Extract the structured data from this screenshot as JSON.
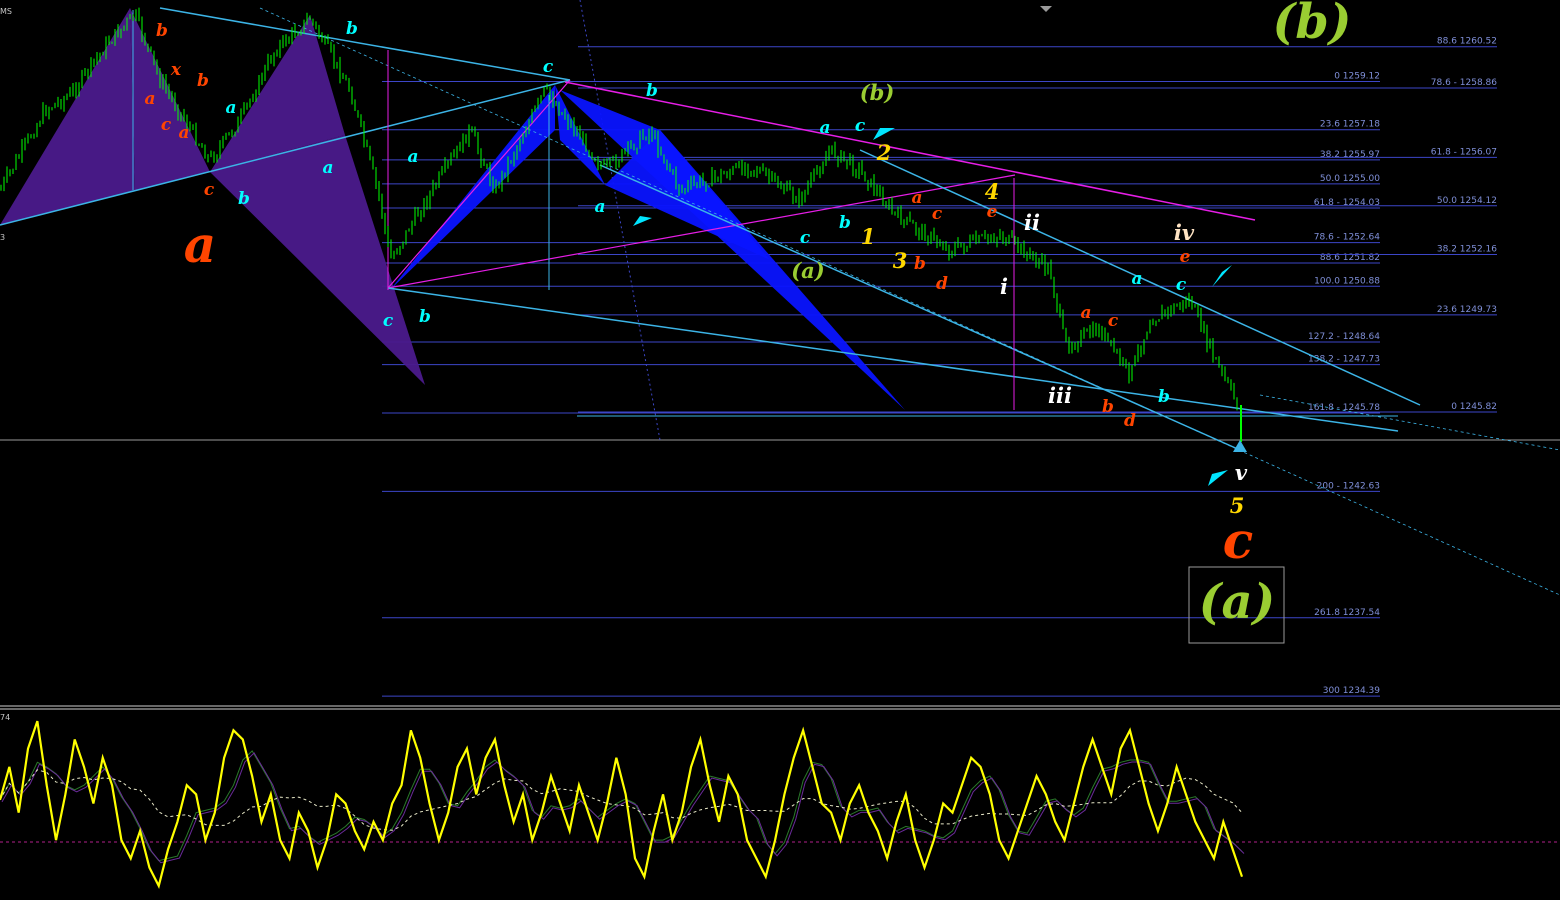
{
  "chart_data": [
    {
      "type": "line",
      "title": "",
      "header_fragment": "MS",
      "left_edge_fragment": "3",
      "fib_levels_left": [
        {
          "label": "0 1259.12",
          "value": 1259.12
        },
        {
          "label": "23.6 1257.18",
          "value": 1257.18
        },
        {
          "label": "38.2 1255.97",
          "value": 1255.97
        },
        {
          "label": "50.0 1255.00",
          "value": 1255.0
        },
        {
          "label": "61.8 - 1254.03",
          "value": 1254.03
        },
        {
          "label": "78.6 - 1252.64",
          "value": 1252.64
        },
        {
          "label": "88.6 1251.82",
          "value": 1251.82
        },
        {
          "label": "100.0 1250.88",
          "value": 1250.88
        },
        {
          "label": "127.2 - 1248.64",
          "value": 1248.64
        },
        {
          "label": "138.2 - 1247.73",
          "value": 1247.73
        },
        {
          "label": "161.8 - 1245.78",
          "value": 1245.78
        },
        {
          "label": "200 - 1242.63",
          "value": 1242.63
        },
        {
          "label": "261.8 1237.54",
          "value": 1237.54
        },
        {
          "label": "300 1234.39",
          "value": 1234.39
        }
      ],
      "fib_levels_right": [
        {
          "label": "88.6 1260.52",
          "value": 1260.52
        },
        {
          "label": "78.6 - 1258.86",
          "value": 1258.86
        },
        {
          "label": "61.8 - 1256.07",
          "value": 1256.07
        },
        {
          "label": "50.0 1254.12",
          "value": 1254.12
        },
        {
          "label": "38.2 1252.16",
          "value": 1252.16
        },
        {
          "label": "23.6 1249.73",
          "value": 1249.73
        },
        {
          "label": "0 1245.82",
          "value": 1245.82
        }
      ],
      "wave_labels": [
        {
          "text": "(b)",
          "color": "#9acd32",
          "size": "xl"
        },
        {
          "text": "(b)",
          "color": "#9acd32",
          "size": "m"
        },
        {
          "text": "(a)",
          "color": "#9acd32",
          "size": "m"
        },
        {
          "text": "(a)",
          "color": "#9acd32",
          "size": "xl"
        },
        {
          "text": "a",
          "color": "#ff4500",
          "size": "xl"
        },
        {
          "text": "c",
          "color": "#ff4500",
          "size": "xl"
        },
        {
          "text": "1",
          "color": "#ffd700",
          "size": "m"
        },
        {
          "text": "2",
          "color": "#ffd700",
          "size": "m"
        },
        {
          "text": "3",
          "color": "#ffd700",
          "size": "m"
        },
        {
          "text": "4",
          "color": "#ffd700",
          "size": "m"
        },
        {
          "text": "5",
          "color": "#ffd700",
          "size": "m"
        },
        {
          "text": "i",
          "color": "#ffffff",
          "size": "m"
        },
        {
          "text": "ii",
          "color": "#ffffff",
          "size": "m"
        },
        {
          "text": "iii",
          "color": "#ffffff",
          "size": "m"
        },
        {
          "text": "iv",
          "color": "#ffe4c4",
          "size": "m"
        },
        {
          "text": "v",
          "color": "#ffffff",
          "size": "m"
        },
        {
          "text": "a",
          "color": "#00ffff",
          "size": "s"
        },
        {
          "text": "b",
          "color": "#00ffff",
          "size": "s"
        },
        {
          "text": "c",
          "color": "#00ffff",
          "size": "s"
        },
        {
          "text": "a",
          "color": "#ff4500",
          "size": "s"
        },
        {
          "text": "b",
          "color": "#ff4500",
          "size": "s"
        },
        {
          "text": "c",
          "color": "#ff4500",
          "size": "s"
        },
        {
          "text": "d",
          "color": "#ff4500",
          "size": "s"
        },
        {
          "text": "e",
          "color": "#ff4500",
          "size": "s"
        },
        {
          "text": "x",
          "color": "#ff4500",
          "size": "s"
        }
      ],
      "colors": {
        "background": "#000000",
        "bull_candle": "#00ff00",
        "trendline_cyan": "#3cb4e6",
        "trendline_magenta": "#e61ee6",
        "pattern_purple": "#4b1a8c",
        "pattern_blue": "#0a14ff",
        "fib_lines": "#3c46c8",
        "oscillator": "#ffff00"
      }
    },
    {
      "type": "line",
      "title": "",
      "header_fragment": "74",
      "series": [
        {
          "values": [
            0.52,
            0.7,
            0.45,
            0.8,
            0.95,
            0.6,
            0.3,
            0.55,
            0.85,
            0.7,
            0.5,
            0.75,
            0.6,
            0.3,
            0.2,
            0.35,
            0.15,
            0.05,
            0.25,
            0.4,
            0.6,
            0.55,
            0.3,
            0.45,
            0.75,
            0.9,
            0.85,
            0.65,
            0.4,
            0.55,
            0.3,
            0.2,
            0.45,
            0.35,
            0.15,
            0.3,
            0.55,
            0.5,
            0.35,
            0.25,
            0.4,
            0.3,
            0.5,
            0.6,
            0.9,
            0.75,
            0.5,
            0.3,
            0.45,
            0.7,
            0.8,
            0.55,
            0.75,
            0.85,
            0.6,
            0.4,
            0.55,
            0.3,
            0.45,
            0.65,
            0.5,
            0.35,
            0.6,
            0.45,
            0.3,
            0.5,
            0.75,
            0.55,
            0.2,
            0.1,
            0.35,
            0.55,
            0.3,
            0.45,
            0.7,
            0.85,
            0.6,
            0.4,
            0.65,
            0.55,
            0.3,
            0.2,
            0.1,
            0.3,
            0.55,
            0.75,
            0.9,
            0.7,
            0.5,
            0.45,
            0.3,
            0.5,
            0.6,
            0.45,
            0.35,
            0.2,
            0.4,
            0.55,
            0.3,
            0.15,
            0.3,
            0.5,
            0.45,
            0.6,
            0.75,
            0.7,
            0.55,
            0.3,
            0.2,
            0.35,
            0.5,
            0.65,
            0.55,
            0.4,
            0.3,
            0.5,
            0.7,
            0.85,
            0.7,
            0.55,
            0.8,
            0.9,
            0.7,
            0.5,
            0.35,
            0.5,
            0.7,
            0.55,
            0.4,
            0.3,
            0.2,
            0.4,
            0.25,
            0.1
          ]
        }
      ]
    }
  ]
}
